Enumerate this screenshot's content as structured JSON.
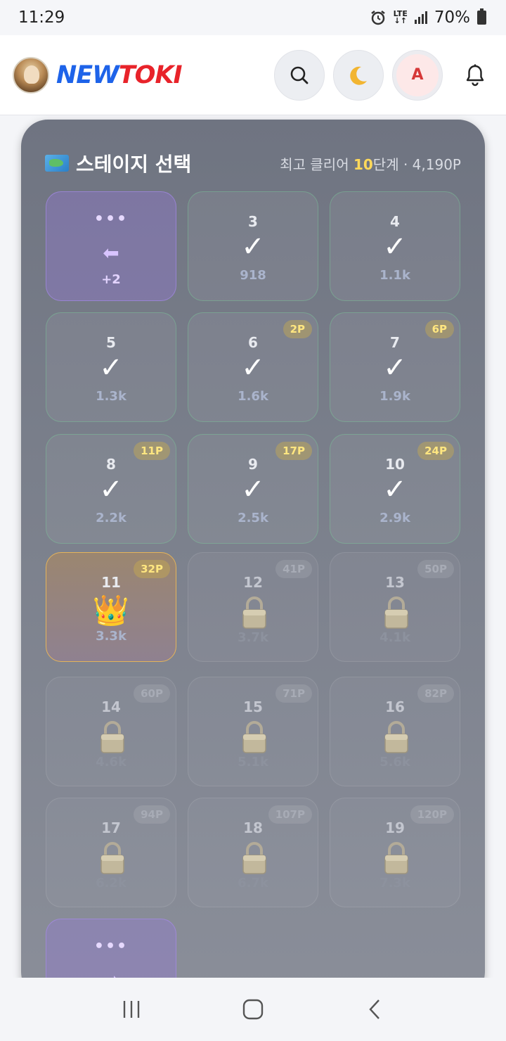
{
  "status_bar": {
    "time": "11:29",
    "network": "LTE",
    "battery": "70%"
  },
  "header": {
    "logo_part1": "NEW",
    "logo_part2": "TOKI",
    "avatar_letter": "A"
  },
  "panel": {
    "title": "스테이지 선택",
    "stat_prefix": "최고 클리어 ",
    "stat_level": "10",
    "stat_suffix": "단계 · 4,190P"
  },
  "prev_group": {
    "dots": "•••",
    "arrow": "⬅",
    "count": "+2"
  },
  "stages": [
    {
      "num": "3",
      "value": "918",
      "badge": "",
      "state": "cleared"
    },
    {
      "num": "4",
      "value": "1.1k",
      "badge": "",
      "state": "cleared"
    },
    {
      "num": "5",
      "value": "1.3k",
      "badge": "",
      "state": "cleared"
    },
    {
      "num": "6",
      "value": "1.6k",
      "badge": "2P",
      "state": "cleared"
    },
    {
      "num": "7",
      "value": "1.9k",
      "badge": "6P",
      "state": "cleared"
    },
    {
      "num": "8",
      "value": "2.2k",
      "badge": "11P",
      "state": "cleared"
    },
    {
      "num": "9",
      "value": "2.5k",
      "badge": "17P",
      "state": "cleared"
    },
    {
      "num": "10",
      "value": "2.9k",
      "badge": "24P",
      "state": "cleared"
    },
    {
      "num": "11",
      "value": "3.3k",
      "badge": "32P",
      "state": "current"
    },
    {
      "num": "12",
      "value": "3.7k",
      "badge": "41P",
      "state": "locked"
    },
    {
      "num": "13",
      "value": "4.1k",
      "badge": "50P",
      "state": "locked"
    },
    {
      "num": "14",
      "value": "4.6k",
      "badge": "60P",
      "state": "locked"
    },
    {
      "num": "15",
      "value": "5.1k",
      "badge": "71P",
      "state": "locked"
    },
    {
      "num": "16",
      "value": "5.6k",
      "badge": "82P",
      "state": "locked"
    },
    {
      "num": "17",
      "value": "6.2k",
      "badge": "94P",
      "state": "locked"
    },
    {
      "num": "18",
      "value": "6.7k",
      "badge": "107P",
      "state": "locked"
    },
    {
      "num": "19",
      "value": "7.3k",
      "badge": "120P",
      "state": "locked"
    }
  ],
  "next_group": {
    "dots": "•••"
  },
  "icons": {
    "check": "✓",
    "crown": "👑"
  }
}
